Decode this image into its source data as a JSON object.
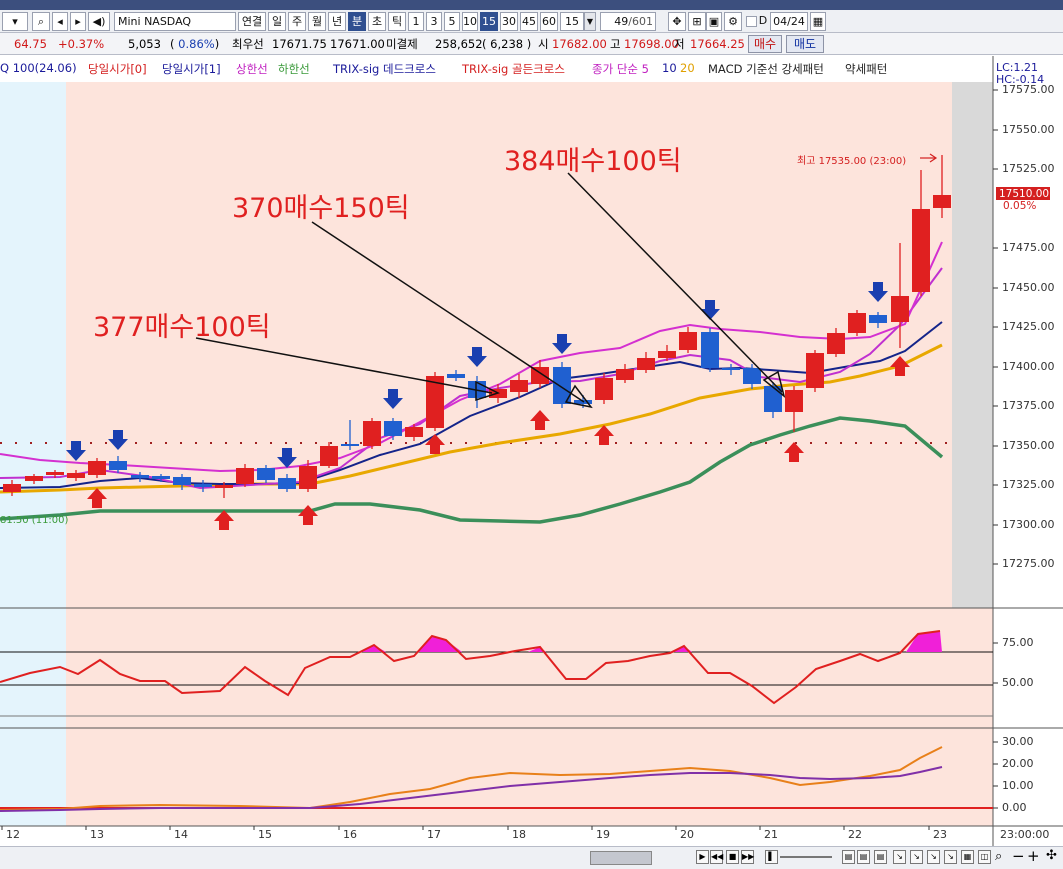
{
  "toolbar": {
    "symbol": "Mini NASDAQ 100(24.0",
    "period_buttons": [
      "연결",
      "일",
      "주",
      "월",
      "년",
      "분",
      "초",
      "틱"
    ],
    "minute_options": [
      "1",
      "3",
      "5",
      "10",
      "15",
      "30",
      "45",
      "60"
    ],
    "selected_period": "분",
    "selected_minute": "15",
    "interval_value": "15",
    "count": "49",
    "total": "/601",
    "date_label": "D",
    "date_value": "04/24"
  },
  "quote": {
    "change": "64.75",
    "change_pct": "+0.37%",
    "volume": "5,053",
    "vol_pct": "0.86%",
    "best_ask_label": "최우선",
    "best_ask": "17671.75",
    "best_bid": "17671.00",
    "open_interest_label": "미결제",
    "open_interest": "258,652",
    "oi_change": "6,238",
    "open_label": "시",
    "open": "17682.00",
    "high_label": "고",
    "high": "17698.00",
    "low_label": "저",
    "low": "17664.25",
    "buy_button": "매수",
    "sell_button": "매도"
  },
  "legend": [
    {
      "text": "Q 100(24.06)",
      "color": "#1a1a9a"
    },
    {
      "text": "당일시가[0]",
      "color": "#d42020"
    },
    {
      "text": "당일시가[1]",
      "color": "#1a1a9a"
    },
    {
      "text": "상한선",
      "color": "#c020c0"
    },
    {
      "text": "하한선",
      "color": "#3a9a3a"
    },
    {
      "text": "TRIX-sig 데드크로스",
      "color": "#1a1a9a"
    },
    {
      "text": "TRIX-sig 골든크로스",
      "color": "#d42020"
    },
    {
      "text": "종가 단순 5",
      "color": "#c020c0"
    },
    {
      "text": "10",
      "color": "#1a1a9a"
    },
    {
      "text": "20",
      "color": "#e0a000"
    },
    {
      "text": "MACD 기준선 강세패턴",
      "color": "#222222"
    },
    {
      "text": "약세패턴",
      "color": "#222222"
    }
  ],
  "right_info": {
    "lc": "LC:1.21",
    "hc": "HC:-0.14"
  },
  "annotations": {
    "a1": "377매수100틱",
    "a2": "370매수150틱",
    "a3": "384매수100틱",
    "high_marker": "최고 17535.00 (23:00)",
    "low_marker": "81.50 (11:00)"
  },
  "price_tag": {
    "value": "17510.00",
    "pct": "0.05%"
  },
  "price_axis": [
    "17575.00",
    "17550.00",
    "17525.00",
    "17500.00",
    "17475.00",
    "17450.00",
    "17425.00",
    "17400.00",
    "17375.00",
    "17350.00",
    "17325.00",
    "17300.00",
    "17275.00"
  ],
  "stoch_axis": [
    "75.00",
    "50.00"
  ],
  "macd_axis": [
    "30.00",
    "20.00",
    "10.00",
    "0.00"
  ],
  "x_labels": [
    "12",
    "13",
    "14",
    "15",
    "16",
    "17",
    "18",
    "19",
    "20",
    "21",
    "22",
    "23"
  ],
  "time_label": "23:00:00",
  "colors": {
    "up": "#e02020",
    "down": "#2060d0",
    "bg": "#fde4dc",
    "premarket": "#e4f4fc"
  }
}
